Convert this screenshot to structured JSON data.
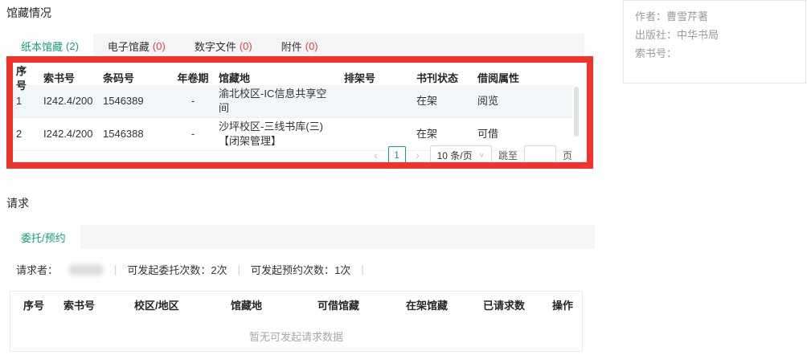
{
  "colors": {
    "accent_teal": "#13a07b",
    "count_red": "#ef3d3d",
    "annotation_red": "#f0342c"
  },
  "collection": {
    "title": "馆藏情况",
    "tabs": [
      {
        "label": "纸本馆藏",
        "count": "(2)",
        "active": true
      },
      {
        "label": "电子馆藏",
        "count": "(0)",
        "active": false
      },
      {
        "label": "数字文件",
        "count": "(0)",
        "active": false
      },
      {
        "label": "附件",
        "count": "(0)",
        "active": false
      }
    ],
    "table": {
      "headers": [
        "序号",
        "索书号",
        "条码号",
        "年卷期",
        "馆藏地",
        "排架号",
        "书刊状态",
        "借阅属性"
      ],
      "rows": [
        [
          "1",
          "I242.4/200",
          "1546389",
          "-",
          "渝北校区-IC信息共享空间",
          "",
          "在架",
          "阅览"
        ],
        [
          "2",
          "I242.4/200",
          "1546388",
          "-",
          "沙坪校区-三线书库(三)【闭架管理】",
          "",
          "在架",
          "可借"
        ]
      ]
    },
    "pagination": {
      "prev_icon": "‹",
      "current_page": "1",
      "next_icon": "›",
      "page_size_label": "10 条/页",
      "caret_icon": "∨",
      "jump_label": "跳至",
      "page_unit": "页"
    }
  },
  "book_info": {
    "author_line": "作者：曹雪芹著",
    "publisher_line": "出版社：中华书局",
    "callno_line": "索书号："
  },
  "request": {
    "title": "请求",
    "tab": {
      "label": "委托/预约",
      "active": true
    },
    "info": {
      "requester_label": "请求者：",
      "separator": "|",
      "delegate_label": "可发起委托次数：",
      "delegate_value": "2次",
      "reserve_label": "可发起预约次数：",
      "reserve_value": "1次"
    },
    "table": {
      "headers": [
        "序号",
        "索书号",
        "校区/地区",
        "馆藏地",
        "可借馆藏",
        "在架馆藏",
        "已请求数",
        "操作"
      ],
      "empty_text": "暂无可发起请求数据"
    }
  }
}
